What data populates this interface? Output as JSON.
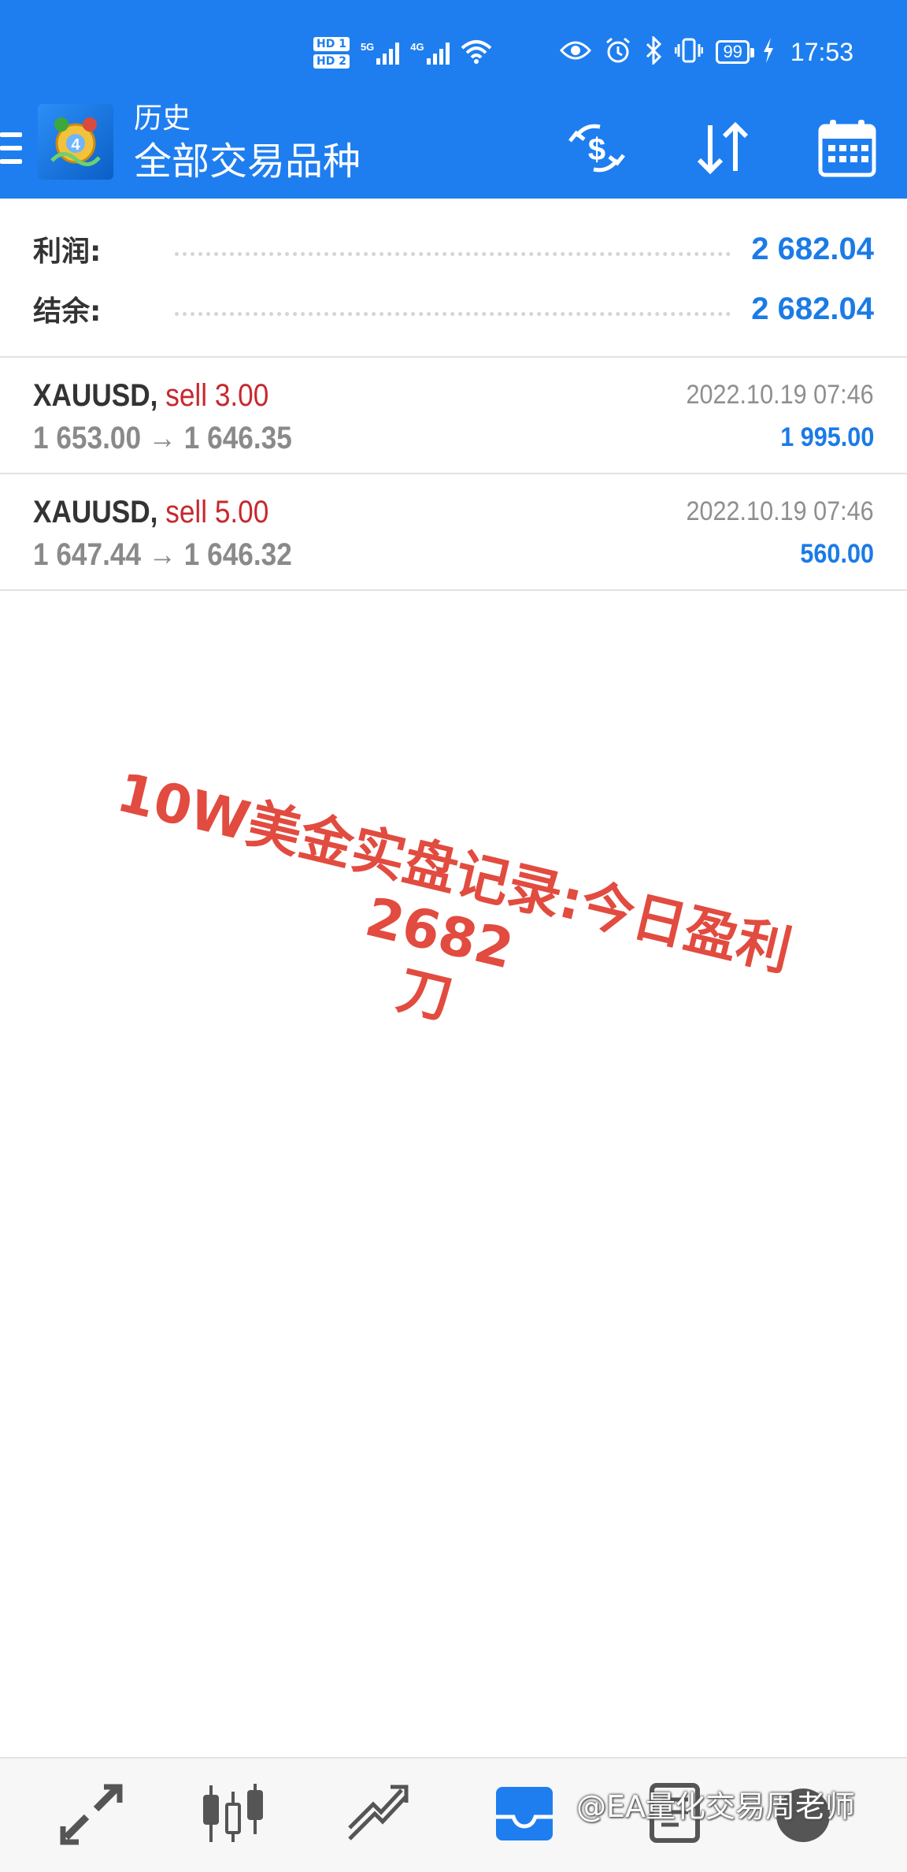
{
  "status_bar": {
    "sim1": "HD 1",
    "sim2": "HD 2",
    "net1_label": "5G",
    "net2_label": "4G",
    "battery": "99",
    "time": "17:53"
  },
  "app_bar": {
    "subtitle": "历史",
    "title": "全部交易品种"
  },
  "summary": {
    "profit_label": "利润:",
    "profit_value": "2 682.04",
    "balance_label": "结余:",
    "balance_value": "2 682.04"
  },
  "deals": [
    {
      "symbol": "XAUUSD,",
      "type": "sell 3.00",
      "prices": "1 653.00 → 1 646.35",
      "time": "2022.10.19 07:46",
      "profit": "1 995.00"
    },
    {
      "symbol": "XAUUSD,",
      "type": "sell 5.00",
      "prices": "1 647.44 → 1 646.32",
      "time": "2022.10.19 07:46",
      "profit": "560.00"
    }
  ],
  "overlay": {
    "line1": "10W美金实盘记录:今日盈利2682",
    "line2": "刀"
  },
  "credit": "@EA量化交易周老师",
  "colors": {
    "header_blue": "#1e7ef0",
    "value_blue": "#1b7be6",
    "sell_red": "#c7282e",
    "overlay_red": "#e24b3f"
  },
  "icons": {
    "app_bar": [
      "menu-icon",
      "mt4-logo-icon",
      "currency-exchange-icon",
      "sort-icon",
      "calendar-icon"
    ],
    "bottom_nav": [
      "quotes-icon",
      "chart-icon",
      "trade-icon",
      "history-icon",
      "news-icon",
      "settings-icon"
    ]
  }
}
